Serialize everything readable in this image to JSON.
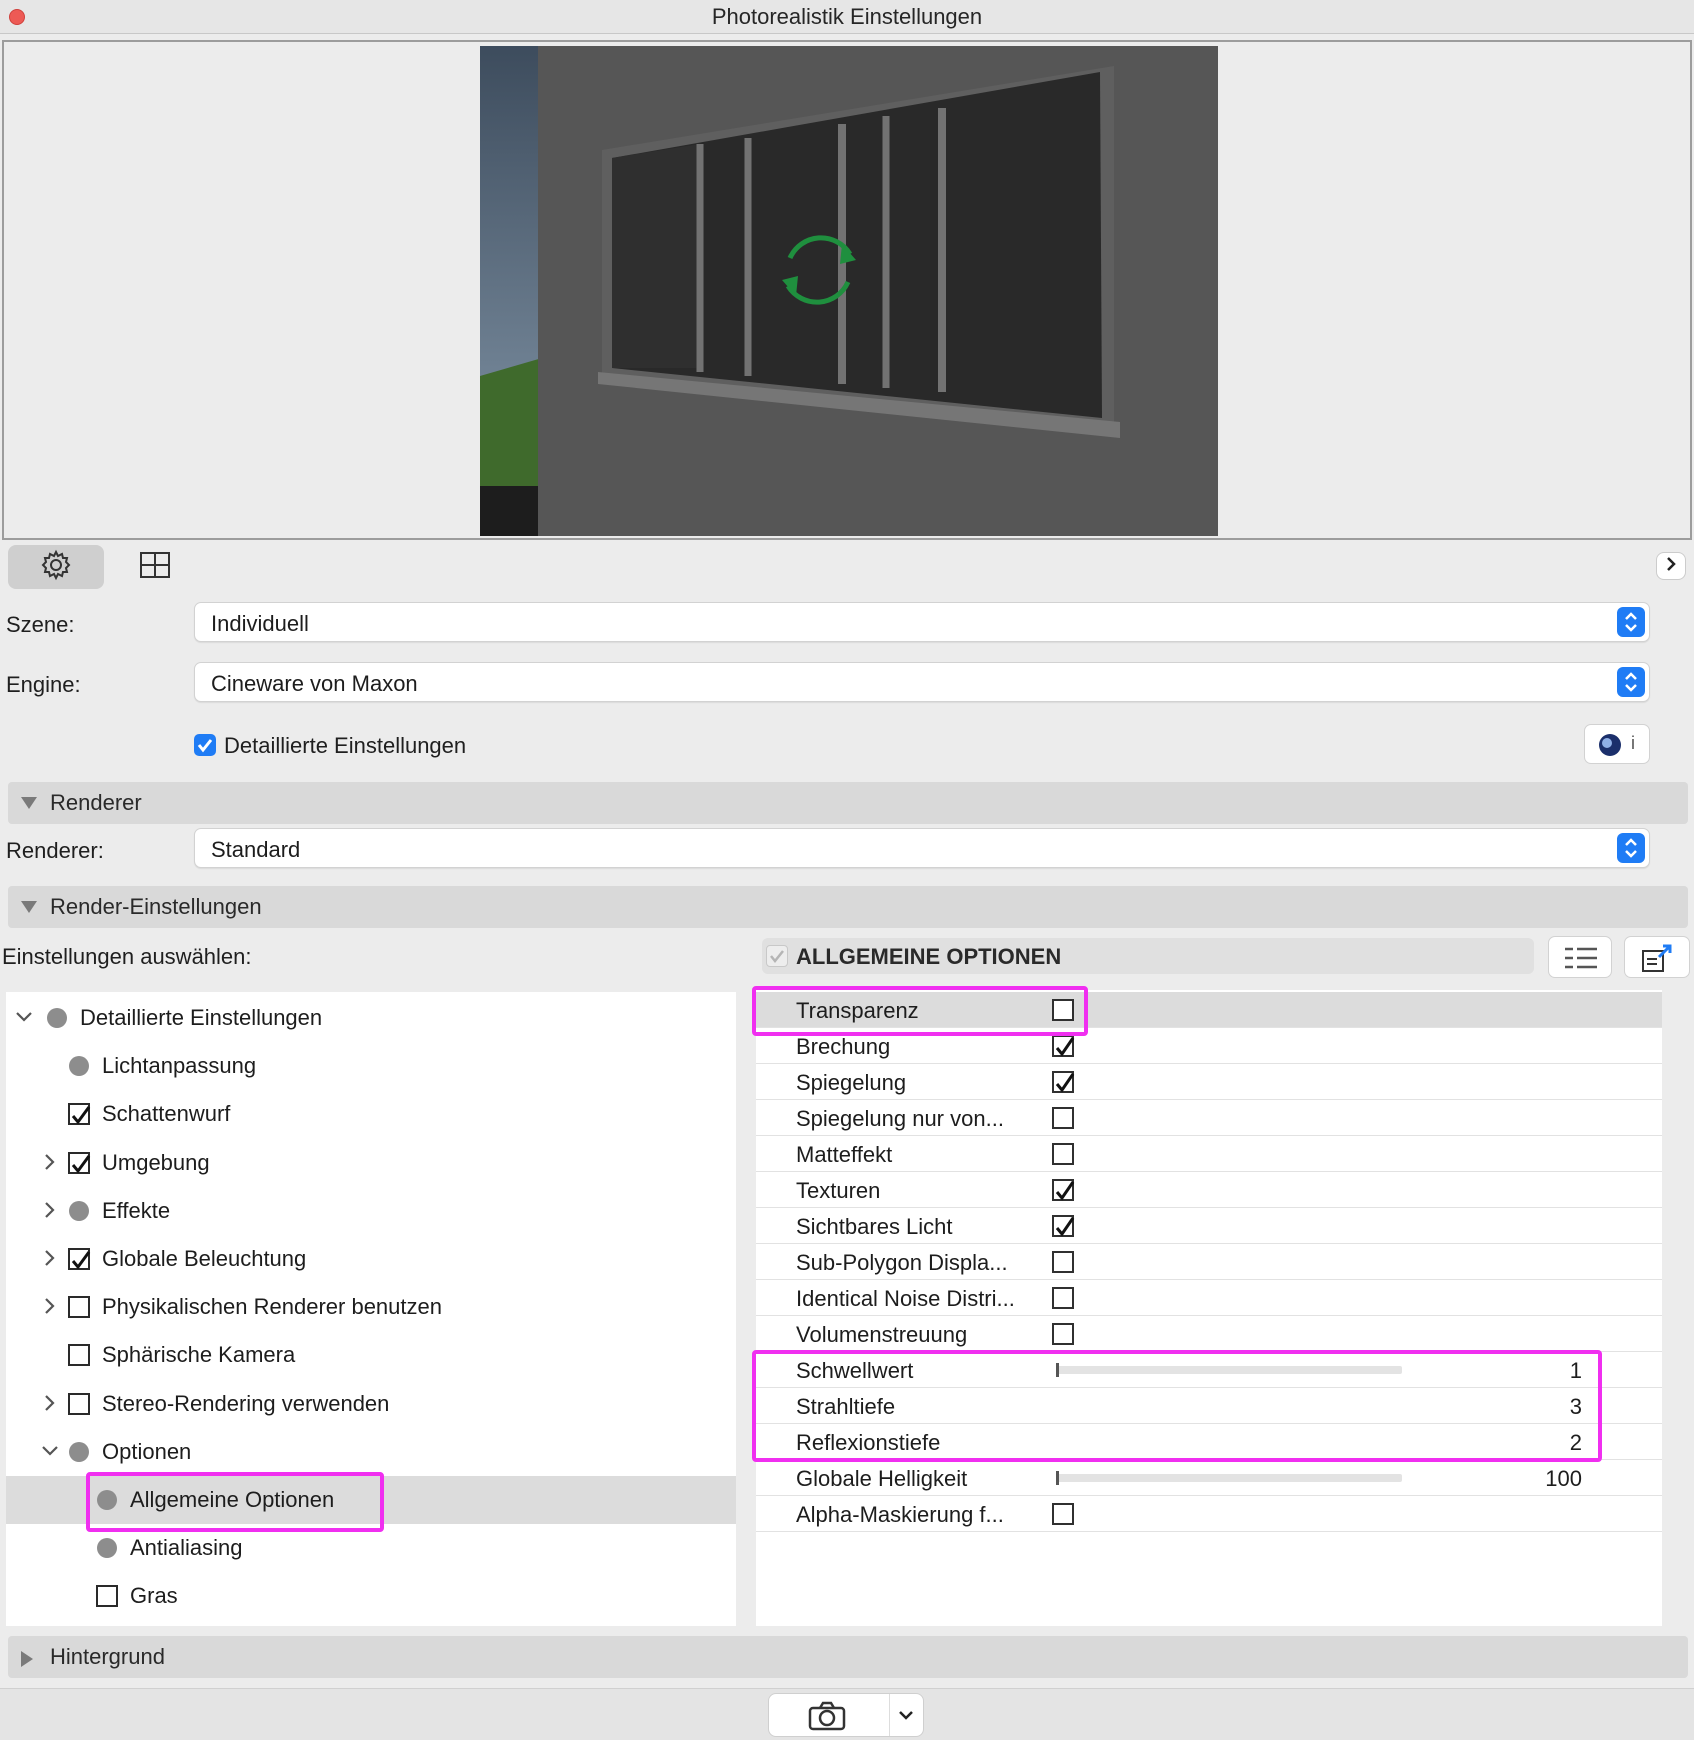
{
  "window": {
    "title": "Photorealistik Einstellungen"
  },
  "toolbar": {
    "settings_icon": "gear-icon",
    "view_icon": "crop-frame-icon",
    "expand_icon": "chevron-right-icon"
  },
  "fields": {
    "scene_label": "Szene:",
    "scene_value": "Individuell",
    "engine_label": "Engine:",
    "engine_value": "Cineware von Maxon",
    "detailed_label": "Detaillierte Einstellungen",
    "info_label": "i"
  },
  "sections": {
    "renderer": "Renderer",
    "renderer_label": "Renderer:",
    "renderer_value": "Standard",
    "render_settings": "Render-Einstellungen",
    "background": "Hintergrund"
  },
  "settings": {
    "choose_label": "Einstellungen auswählen:",
    "group_title": "ALLGEMEINE OPTIONEN"
  },
  "tree": [
    {
      "label": "Detaillierte Einstellungen",
      "marker": "bullet",
      "chevron": "down",
      "level": 0
    },
    {
      "label": "Lichtanpassung",
      "marker": "bullet",
      "chevron": "",
      "level": 1
    },
    {
      "label": "Schattenwurf",
      "marker": "checked",
      "chevron": "",
      "level": 1
    },
    {
      "label": "Umgebung",
      "marker": "checked",
      "chevron": "right",
      "level": 1
    },
    {
      "label": "Effekte",
      "marker": "bullet",
      "chevron": "right",
      "level": 1
    },
    {
      "label": "Globale Beleuchtung",
      "marker": "checked",
      "chevron": "right",
      "level": 1
    },
    {
      "label": "Physikalischen Renderer benutzen",
      "marker": "unchecked",
      "chevron": "right",
      "level": 1
    },
    {
      "label": "Sphärische Kamera",
      "marker": "unchecked",
      "chevron": "",
      "level": 1
    },
    {
      "label": "Stereo-Rendering verwenden",
      "marker": "unchecked",
      "chevron": "right",
      "level": 1
    },
    {
      "label": "Optionen",
      "marker": "bullet",
      "chevron": "down",
      "level": 1
    },
    {
      "label": "Allgemeine Optionen",
      "marker": "bullet",
      "chevron": "",
      "level": 2,
      "selected": true
    },
    {
      "label": "Antialiasing",
      "marker": "bullet",
      "chevron": "",
      "level": 2
    },
    {
      "label": "Gras",
      "marker": "unchecked",
      "chevron": "",
      "level": 2
    }
  ],
  "properties": [
    {
      "label": "Transparenz",
      "type": "checkbox",
      "checked": false,
      "selected": true
    },
    {
      "label": "Brechung",
      "type": "checkbox",
      "checked": true
    },
    {
      "label": "Spiegelung",
      "type": "checkbox",
      "checked": true
    },
    {
      "label": "Spiegelung nur von...",
      "type": "checkbox",
      "checked": false
    },
    {
      "label": "Matteffekt",
      "type": "checkbox",
      "checked": false
    },
    {
      "label": "Texturen",
      "type": "checkbox",
      "checked": true
    },
    {
      "label": "Sichtbares Licht",
      "type": "checkbox",
      "checked": true
    },
    {
      "label": "Sub-Polygon Displa...",
      "type": "checkbox",
      "checked": false
    },
    {
      "label": "Identical Noise Distri...",
      "type": "checkbox",
      "checked": false
    },
    {
      "label": "Volumenstreuung",
      "type": "checkbox",
      "checked": false
    },
    {
      "label": "Schwellwert",
      "type": "slider",
      "value": "1"
    },
    {
      "label": "Strahltiefe",
      "type": "number",
      "value": "3"
    },
    {
      "label": "Reflexionstiefe",
      "type": "number",
      "value": "2"
    },
    {
      "label": "Globale Helligkeit",
      "type": "slider",
      "value": "100"
    },
    {
      "label": "Alpha-Maskierung f...",
      "type": "checkbox",
      "checked": false
    }
  ],
  "colors": {
    "accent": "#1f7cf5",
    "highlight": "#f02ff0",
    "selection": "#dcdcdc"
  }
}
